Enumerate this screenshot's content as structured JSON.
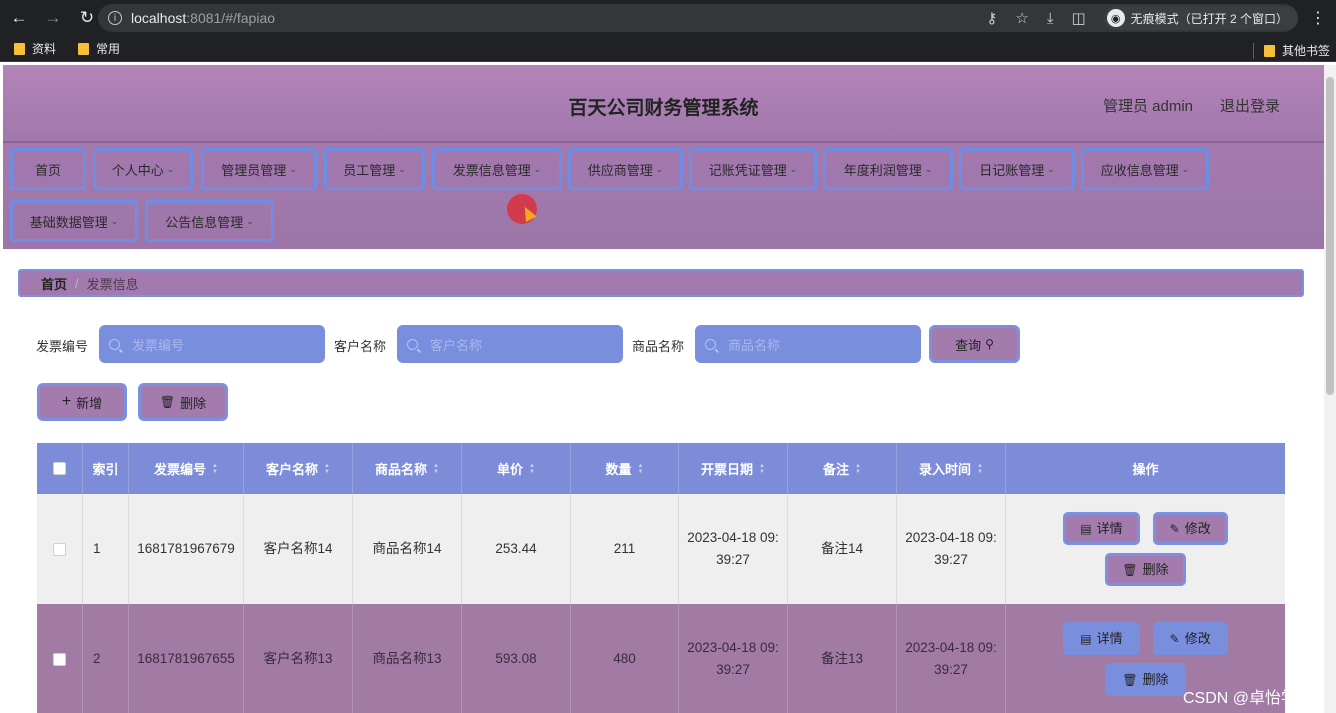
{
  "browser": {
    "url_host": "localhost",
    "url_path": ":8081/#/fapiao",
    "incognito_label": "无痕模式（已打开 2 个窗口）",
    "bookmarks": [
      "资料",
      "常用"
    ],
    "other_bookmarks": "其他书签"
  },
  "header": {
    "title": "百天公司财务管理系统",
    "user": "管理员 admin",
    "logout": "退出登录"
  },
  "menu": {
    "items": [
      "首页",
      "个人中心",
      "管理员管理",
      "员工管理",
      "发票信息管理",
      "供应商管理",
      "记账凭证管理",
      "年度利润管理",
      "日记账管理",
      "应收信息管理",
      "基础数据管理",
      "公告信息管理"
    ]
  },
  "breadcrumb": {
    "home": "首页",
    "current": "发票信息"
  },
  "search": {
    "invoice_label": "发票编号",
    "invoice_placeholder": "发票编号",
    "customer_label": "客户名称",
    "customer_placeholder": "客户名称",
    "product_label": "商品名称",
    "product_placeholder": "商品名称",
    "query_button": "查询"
  },
  "actions": {
    "add": "新增",
    "delete": "删除"
  },
  "table": {
    "headers": [
      "索引",
      "发票编号",
      "客户名称",
      "商品名称",
      "单价",
      "数量",
      "开票日期",
      "备注",
      "录入时间",
      "操作"
    ],
    "rows": [
      {
        "index": "1",
        "invoice_no": "1681781967679",
        "customer": "客户名称14",
        "product": "商品名称14",
        "price": "253.44",
        "qty": "211",
        "date": "2023-04-18 09:39:27",
        "remark": "备注14",
        "entry_time": "2023-04-18 09:39:27"
      },
      {
        "index": "2",
        "invoice_no": "1681781967655",
        "customer": "客户名称13",
        "product": "商品名称13",
        "price": "593.08",
        "qty": "480",
        "date": "2023-04-18 09:39:27",
        "remark": "备注13",
        "entry_time": "2023-04-18 09:39:27"
      }
    ],
    "op_detail": "详情",
    "op_edit": "修改",
    "op_delete": "删除"
  },
  "watermark": "CSDN @卓怡学长"
}
